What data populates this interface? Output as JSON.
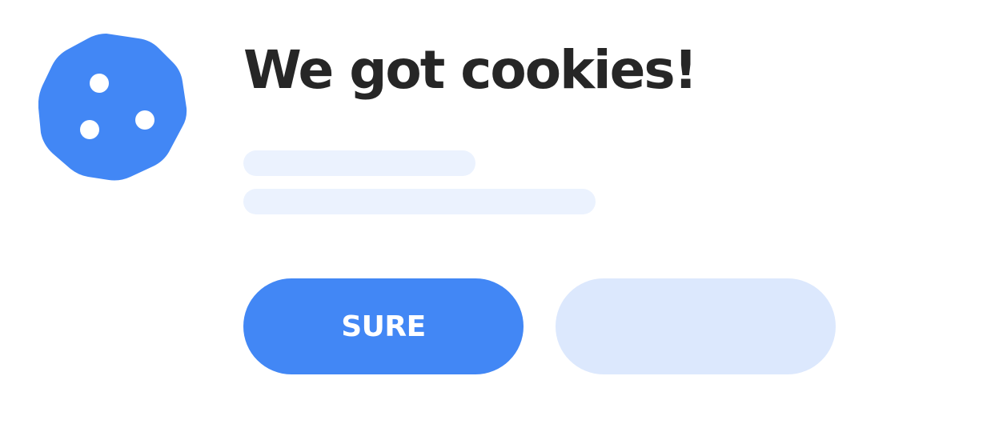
{
  "dialog": {
    "title": "We got cookies!",
    "accept_label": "SURE",
    "secondary_label": ""
  },
  "icons": {
    "cookie": "cookie-icon"
  },
  "colors": {
    "accent": "#4287f5",
    "secondary_button": "#dce8fd",
    "placeholder": "#ebf2fe",
    "title_text": "#262626",
    "button_text": "#ffffff"
  }
}
